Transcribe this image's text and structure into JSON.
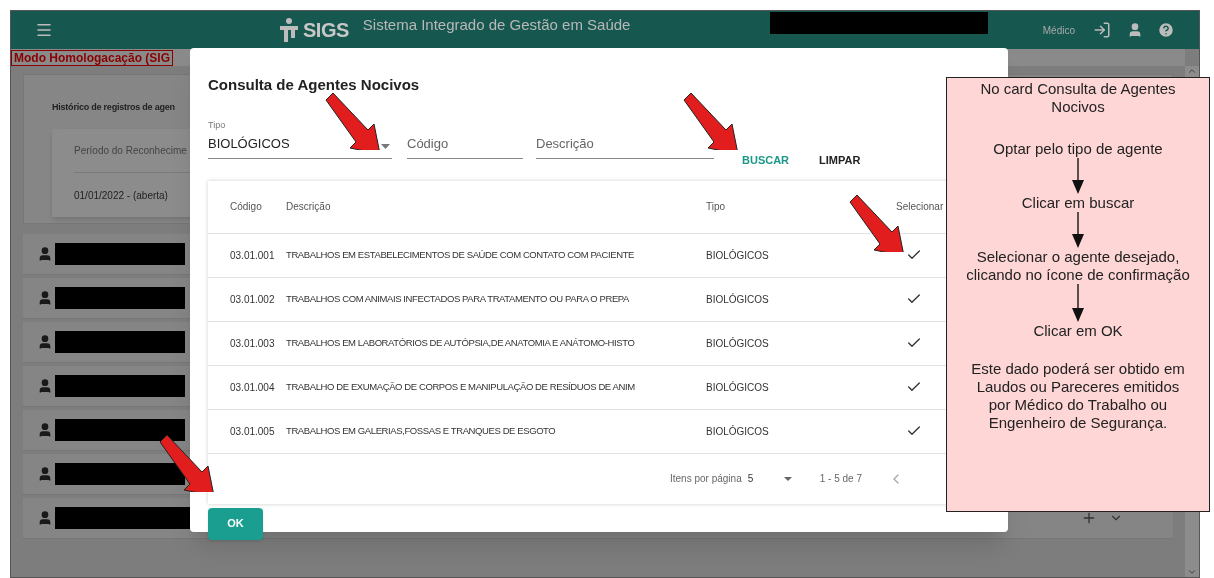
{
  "header": {
    "logo": "SIGS",
    "title": "Sistema Integrado de Gestão em Saúde",
    "role": "Médico"
  },
  "banner": "Modo Homologacação (SIG",
  "history_card": {
    "title": "Histórico de registros de agen",
    "column": "Período do Reconhecime",
    "value": "01/01/2022 - (aberta)"
  },
  "person_rows": [
    {
      "kind": "redacted"
    },
    {
      "kind": "redacted"
    },
    {
      "kind": "redacted"
    },
    {
      "kind": "redacted"
    },
    {
      "kind": "redacted"
    },
    {
      "kind": "redacted"
    },
    {
      "kind": "redacted_wide"
    }
  ],
  "dialog": {
    "title": "Consulta de Agentes Nocivos",
    "tipo": {
      "label": "Tipo",
      "value": "BIOLÓGICOS"
    },
    "codigo": {
      "placeholder": "Código"
    },
    "descricao": {
      "placeholder": "Descrição"
    },
    "buttons": {
      "search": "BUSCAR",
      "clear": "LIMPAR",
      "ok": "OK"
    },
    "table": {
      "columns": [
        "Código",
        "Descrição",
        "Tipo",
        "Selecionar"
      ],
      "rows": [
        {
          "codigo": "03.01.001",
          "descricao": "TRABALHOS EM ESTABELECIMENTOS DE SAÚDE COM CONTATO COM PACIENTE",
          "tipo": "BIOLÓGICOS"
        },
        {
          "codigo": "03.01.002",
          "descricao": "TRABALHOS COM ANIMAIS INFECTADOS PARA TRATAMENTO OU PARA O PREPA",
          "tipo": "BIOLÓGICOS"
        },
        {
          "codigo": "03.01.003",
          "descricao": "TRABALHOS EM LABORATÓRIOS DE AUTÓPSIA,DE ANATOMIA E ANÁTOMO-HISTO",
          "tipo": "BIOLÓGICOS"
        },
        {
          "codigo": "03.01.004",
          "descricao": "TRABALHO DE EXUMAÇÃO DE CORPOS E MANIPULAÇÃO DE RESÍDUOS DE ANIM",
          "tipo": "BIOLÓGICOS"
        },
        {
          "codigo": "03.01.005",
          "descricao": "TRABALHOS EM GALERIAS,FOSSAS E TRANQUES DE ESGOTO",
          "tipo": "BIOLÓGICOS"
        }
      ]
    },
    "pagination": {
      "label": "Itens por página",
      "per_page": "5",
      "range": "1 - 5 de 7"
    }
  },
  "callout": {
    "intro": "No card Consulta de Agentes Nocivos",
    "steps": [
      "Optar pelo tipo de agente",
      "Clicar em buscar",
      "Selecionar o agente desejado, clicando no ícone de confirmação",
      "Clicar em OK"
    ],
    "note": "Este dado poderá ser obtido em Laudos ou Pareceres emitidos por Médico do Trabalho ou Engenheiro de Segurança."
  }
}
